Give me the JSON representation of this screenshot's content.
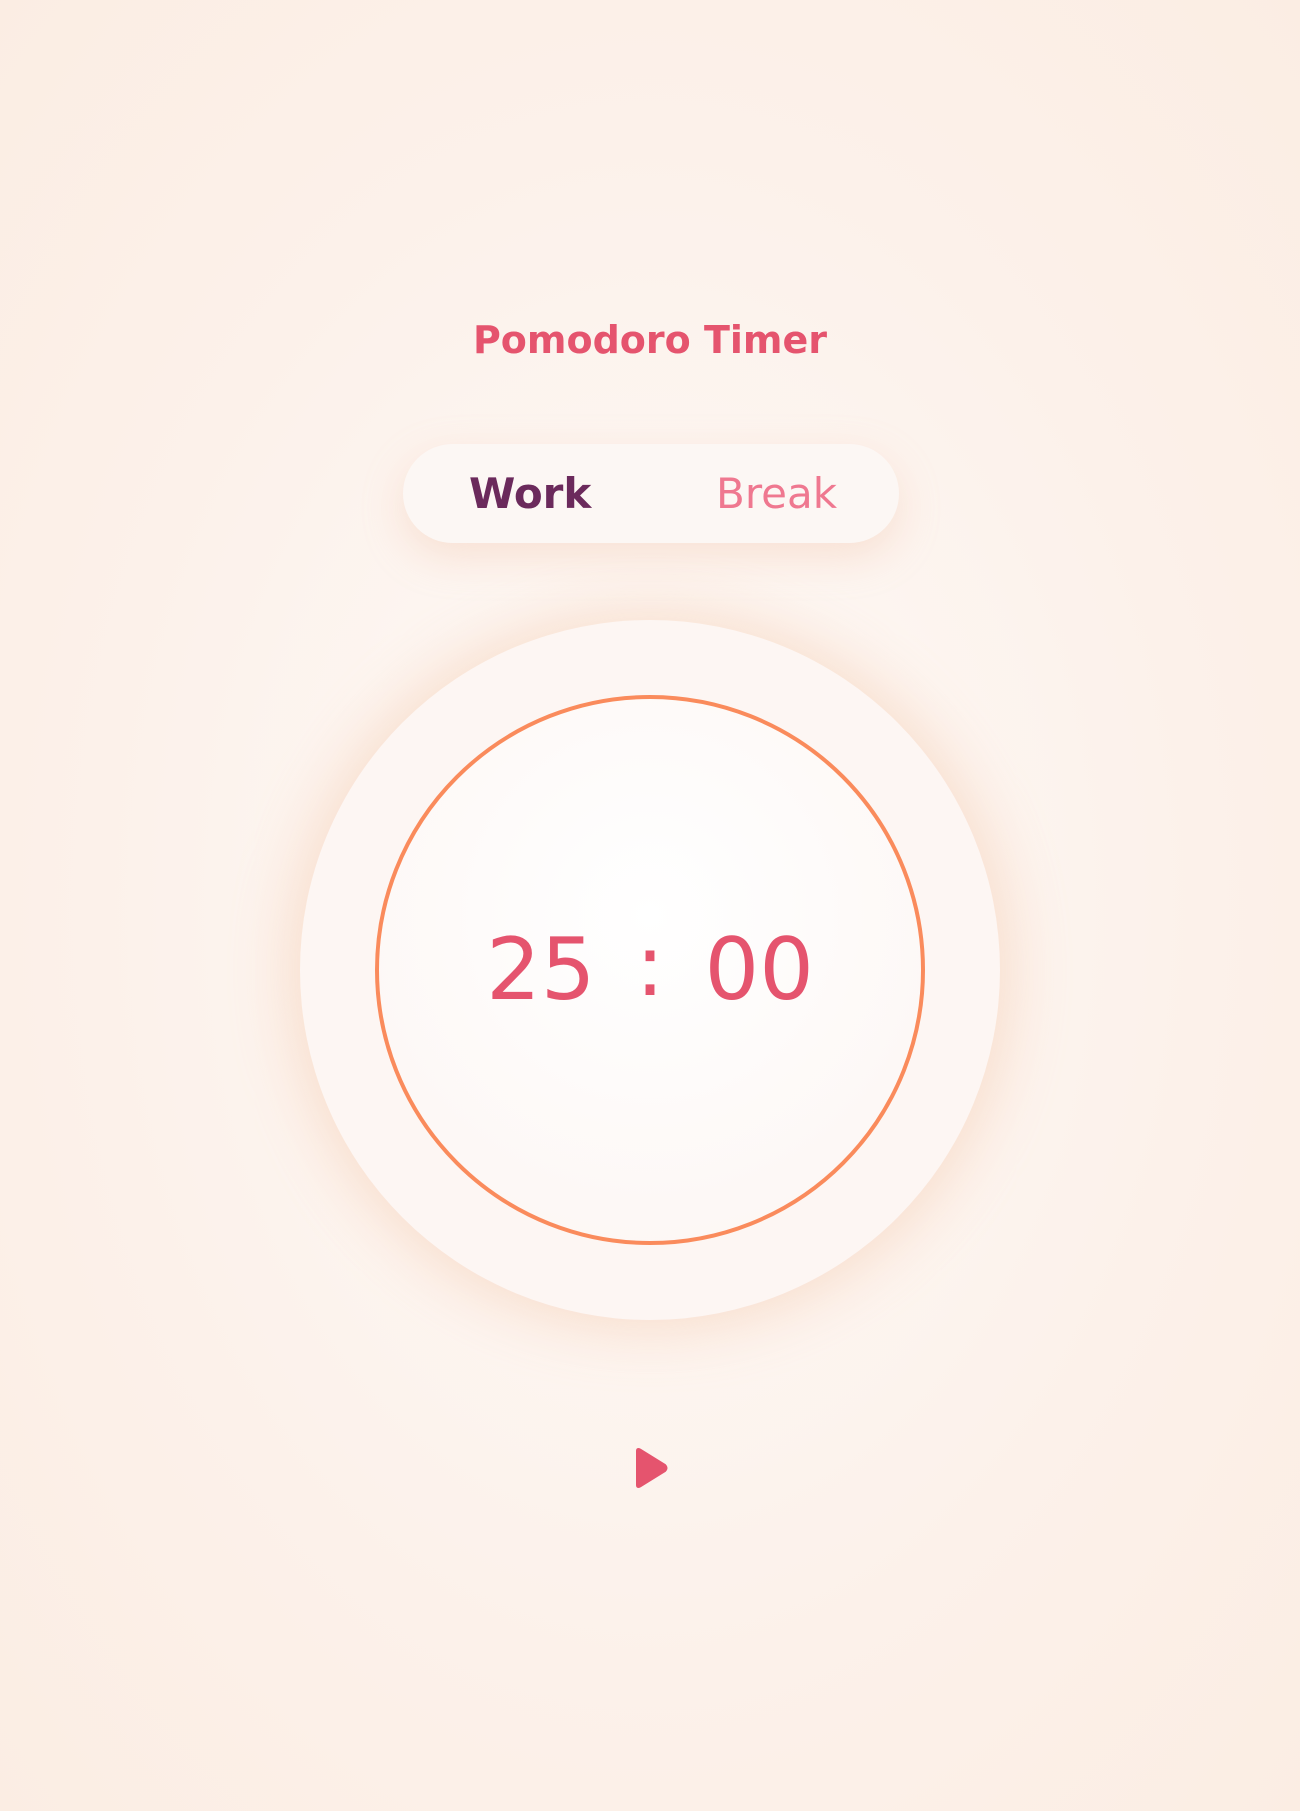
{
  "app": {
    "title": "Pomodoro Timer"
  },
  "mode_toggle": {
    "tabs": [
      {
        "label": "Work",
        "active": true
      },
      {
        "label": "Break",
        "active": false
      }
    ]
  },
  "timer": {
    "minutes": "25",
    "separator": ":",
    "seconds": "00",
    "progress": 1.0
  },
  "controls": {
    "play_icon": "play-icon"
  },
  "colors": {
    "accent": "#e5546e",
    "active_tab": "#6b2a5c",
    "inactive_tab": "#ef7890",
    "ring": "#fa8b5c"
  }
}
